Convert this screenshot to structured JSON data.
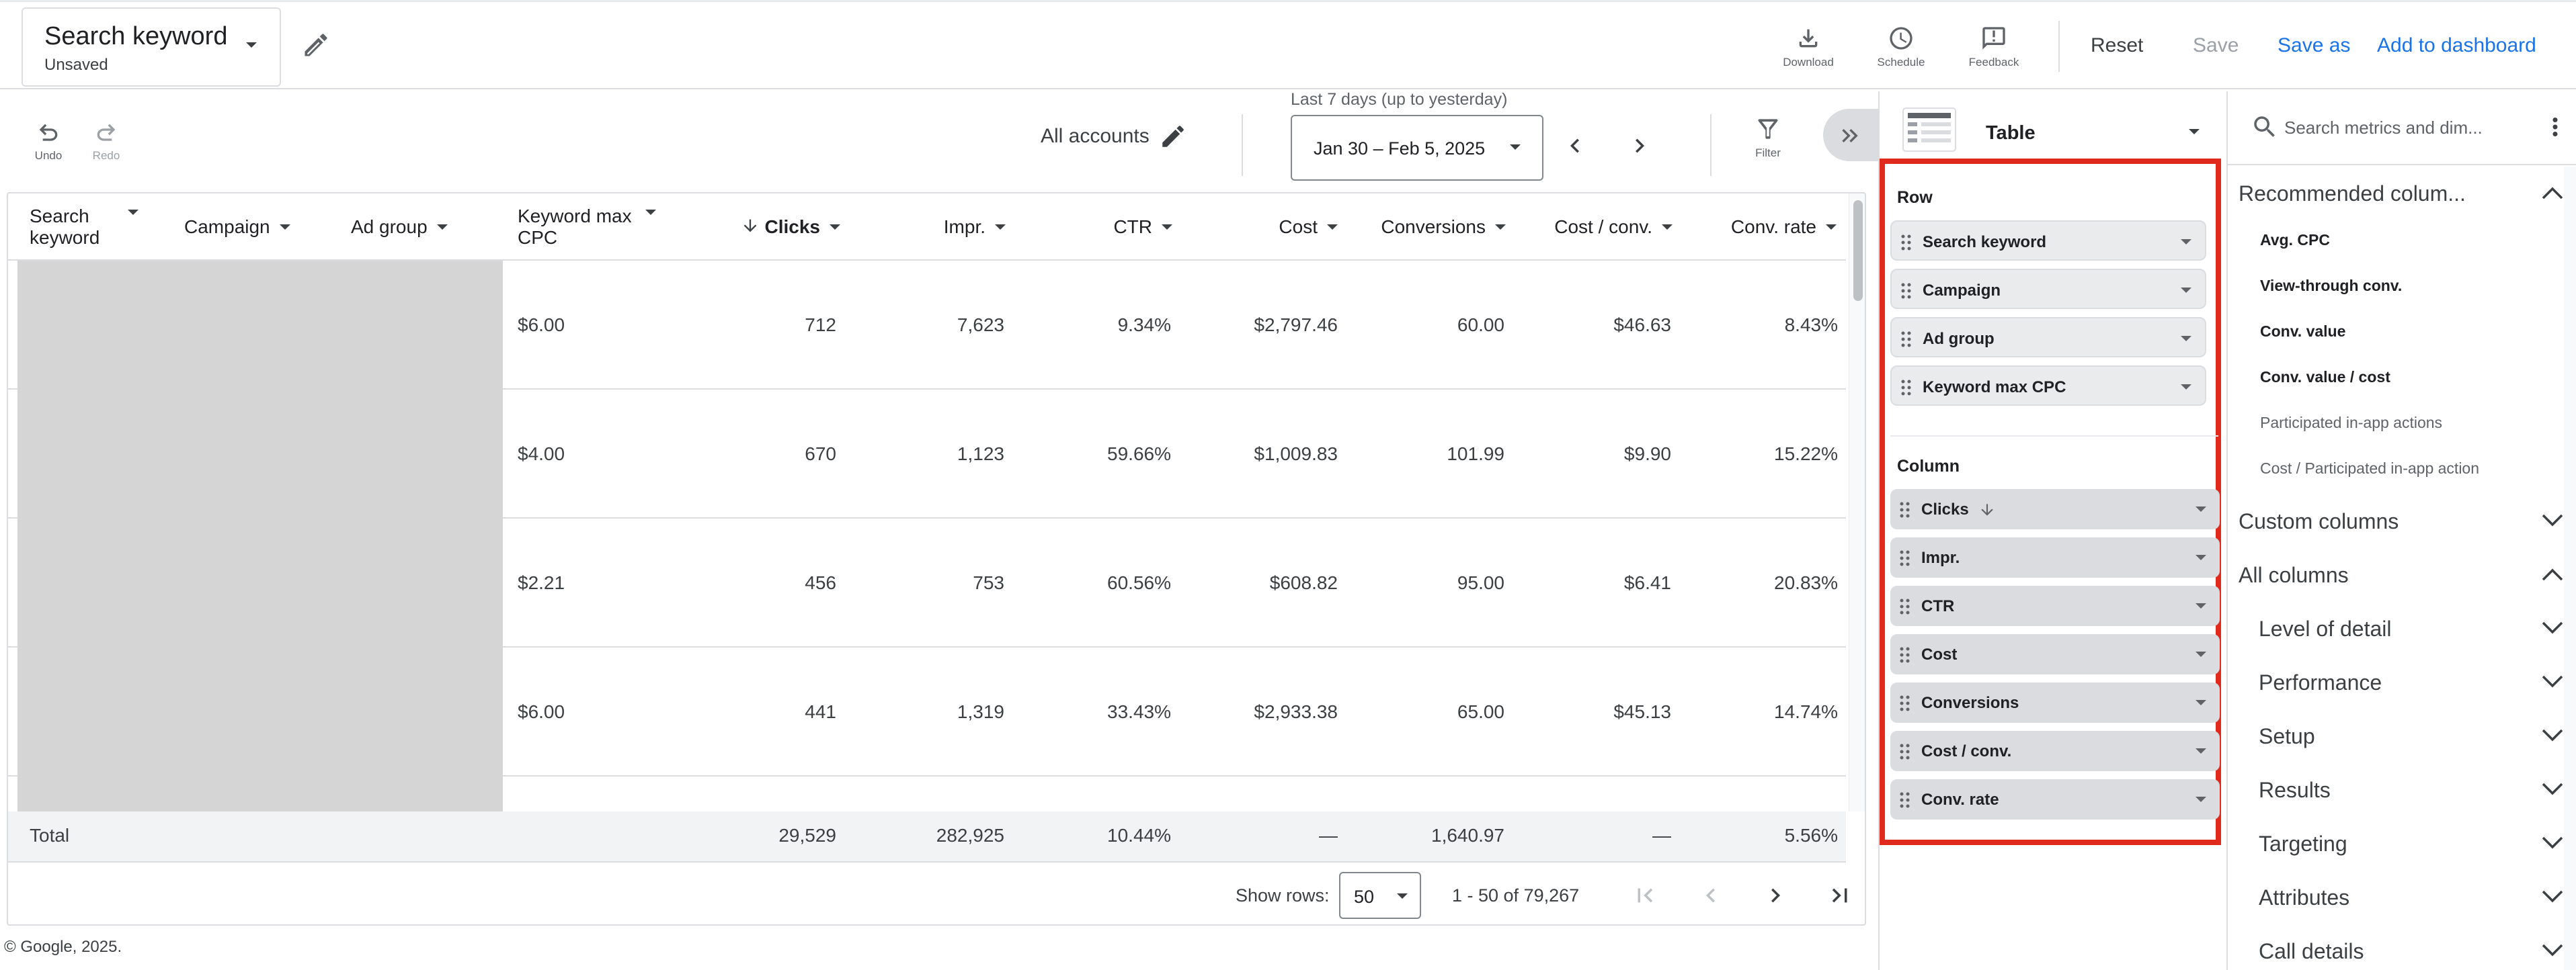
{
  "header": {
    "report_title": "Search keyword",
    "report_status": "Unsaved",
    "actions": {
      "download": "Download",
      "schedule": "Schedule",
      "feedback": "Feedback"
    },
    "reset": "Reset",
    "save": "Save",
    "save_as": "Save as",
    "add_to_dashboard": "Add to dashboard"
  },
  "toolbar": {
    "undo": "Undo",
    "redo": "Redo",
    "accounts": "All accounts",
    "date_caption": "Last 7 days (up to yesterday)",
    "date_range": "Jan 30 – Feb 5, 2025",
    "filter": "Filter"
  },
  "table": {
    "headers": {
      "search_keyword": [
        "Search",
        "keyword"
      ],
      "campaign": "Campaign",
      "ad_group": "Ad group",
      "keyword_max_cpc": [
        "Keyword max",
        "CPC"
      ],
      "clicks": "Clicks",
      "impr": "Impr.",
      "ctr": "CTR",
      "cost": "Cost",
      "conversions": "Conversions",
      "cost_per_conv": "Cost / conv.",
      "conv_rate": "Conv. rate"
    },
    "rows": [
      {
        "max_cpc": "$6.00",
        "clicks": "712",
        "impr": "7,623",
        "ctr": "9.34%",
        "cost": "$2,797.46",
        "conversions": "60.00",
        "cost_per_conv": "$46.63",
        "conv_rate": "8.43%"
      },
      {
        "max_cpc": "$4.00",
        "clicks": "670",
        "impr": "1,123",
        "ctr": "59.66%",
        "cost": "$1,009.83",
        "conversions": "101.99",
        "cost_per_conv": "$9.90",
        "conv_rate": "15.22%"
      },
      {
        "max_cpc": "$2.21",
        "clicks": "456",
        "impr": "753",
        "ctr": "60.56%",
        "cost": "$608.82",
        "conversions": "95.00",
        "cost_per_conv": "$6.41",
        "conv_rate": "20.83%"
      },
      {
        "max_cpc": "$6.00",
        "clicks": "441",
        "impr": "1,319",
        "ctr": "33.43%",
        "cost": "$2,933.38",
        "conversions": "65.00",
        "cost_per_conv": "$45.13",
        "conv_rate": "14.74%"
      }
    ],
    "total": {
      "label": "Total",
      "clicks": "29,529",
      "impr": "282,925",
      "ctr": "10.44%",
      "cost": "—",
      "conversions": "1,640.97",
      "cost_per_conv": "—",
      "conv_rate": "5.56%"
    },
    "pagination": {
      "show_rows_label": "Show rows:",
      "rows_per_page": "50",
      "range": "1 - 50 of 79,267"
    }
  },
  "footer": {
    "copyright": "© Google, 2025."
  },
  "layout_panel": {
    "visualization": "Table",
    "row_label": "Row",
    "rows": [
      "Search keyword",
      "Campaign",
      "Ad group",
      "Keyword max CPC"
    ],
    "column_label": "Column",
    "columns": [
      "Clicks",
      "Impr.",
      "CTR",
      "Cost",
      "Conversions",
      "Cost / conv.",
      "Conv. rate"
    ]
  },
  "metrics_panel": {
    "search_placeholder": "Search metrics and dim...",
    "recommended_label": "Recommended colum...",
    "recommended": [
      {
        "label": "Avg. CPC",
        "enabled": true
      },
      {
        "label": "View-through conv.",
        "enabled": true
      },
      {
        "label": "Conv. value",
        "enabled": true
      },
      {
        "label": "Conv. value / cost",
        "enabled": true
      },
      {
        "label": "Participated in-app actions",
        "enabled": false
      },
      {
        "label": "Cost / Participated in-app action",
        "enabled": false
      }
    ],
    "custom_columns": "Custom columns",
    "all_columns": "All columns",
    "all_column_groups": [
      "Level of detail",
      "Performance",
      "Setup",
      "Results",
      "Targeting",
      "Attributes",
      "Call details"
    ]
  },
  "colors": {
    "accent_blue": "#1a73e8",
    "highlight_red": "#e02a1c",
    "disabled_gray": "#9aa0a6"
  }
}
